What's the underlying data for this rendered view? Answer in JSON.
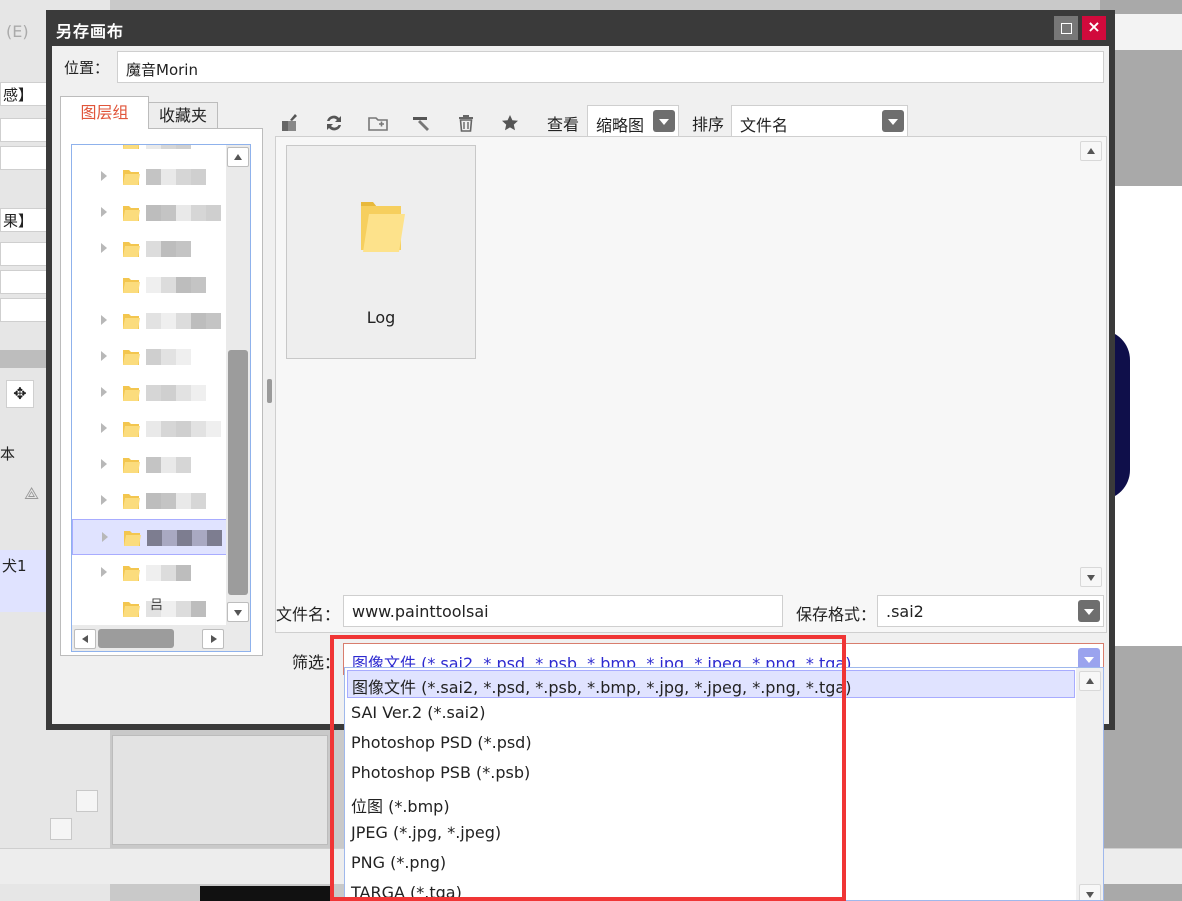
{
  "background": {
    "menu_fragment": "(E)",
    "left_labels": [
      "感】",
      "果】",
      "本",
      "犬1"
    ]
  },
  "dialog": {
    "title": "另存画布",
    "close_glyph": "×",
    "location": {
      "label": "位置：",
      "value": "魔音Morin"
    },
    "tabs": [
      "图层组",
      "收藏夹"
    ],
    "toolbar": {
      "icons": [
        "move-up-icon",
        "refresh-icon",
        "new-folder-icon",
        "rename-icon",
        "trash-icon",
        "star-icon"
      ],
      "view_label": "查看",
      "view_value": "缩略图",
      "sort_label": "排序",
      "sort_value": "文件名"
    },
    "files": [
      {
        "name": "Log",
        "icon": "folder-icon"
      }
    ],
    "filename": {
      "label": "文件名：",
      "value": "www.painttoolsai"
    },
    "format": {
      "label": "保存格式：",
      "value": ".sai2"
    },
    "filter": {
      "label": "筛选：",
      "value": "图像文件 (*.sai2, *.psd, *.psb, *.bmp, *.jpg, *.jpeg, *.png, *.tga)",
      "options": [
        "图像文件 (*.sai2, *.psd, *.psb, *.bmp, *.jpg, *.jpeg, *.png, *.tga)",
        "SAI Ver.2 (*.sai2)",
        "Photoshop PSD (*.psd)",
        "Photoshop PSB (*.psb)",
        "位图 (*.bmp)",
        "JPEG (*.jpg, *.jpeg)",
        "PNG (*.png)",
        "TARGA (*.tga)"
      ]
    },
    "tree_fragment": "吕"
  },
  "colors": {
    "titlebar": "#3a3a3a",
    "close": "#d10a3c",
    "active_tab": "#e0553a",
    "selection": "#e0e3ff",
    "highlight": "#f03535",
    "filter_text": "#2d2ad0"
  }
}
